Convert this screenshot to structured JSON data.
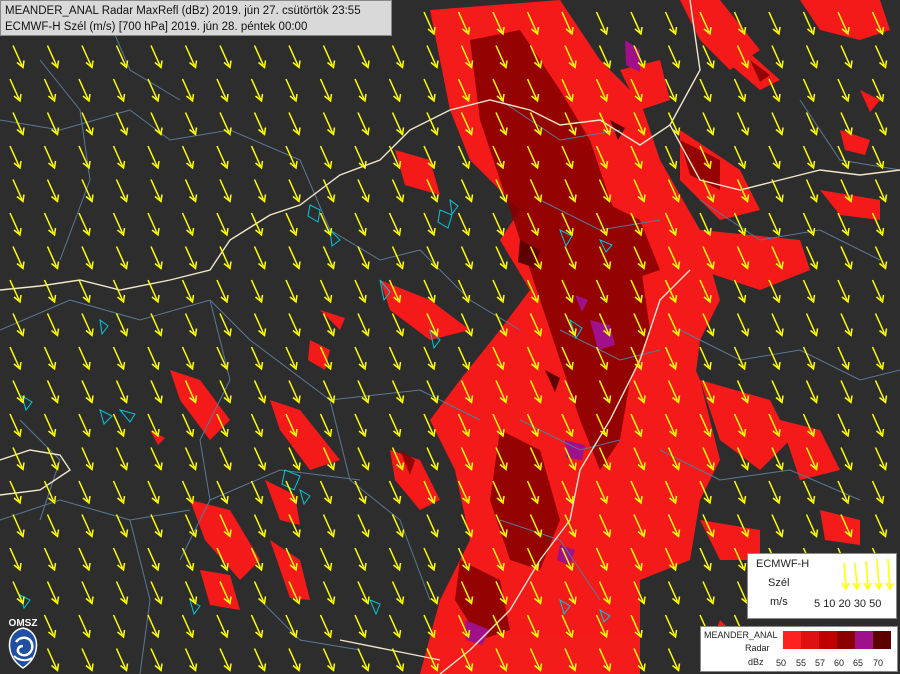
{
  "header": {
    "radar_line": "MEANDER_ANAL Radar MaxRefl (dBz) 2019. jún 27. csütörtök 23:55",
    "wind_line": "ECMWF-H Szél (m/s) [700 hPa] 2019. jún 28. péntek 00:00"
  },
  "wind_legend": {
    "model": "ECMWF-H",
    "variable": "Szél",
    "unit": "m/s",
    "ticks": [
      "5",
      "10",
      "20",
      "30",
      "50"
    ]
  },
  "radar_legend": {
    "model": "MEANDER_ANAL",
    "variable": "Radar",
    "unit": "dBz",
    "classes": [
      {
        "label": "50",
        "color": "#ff2020"
      },
      {
        "label": "55",
        "color": "#e01010"
      },
      {
        "label": "57",
        "color": "#c00000"
      },
      {
        "label": "60",
        "color": "#8b0000"
      },
      {
        "label": "65",
        "color": "#a0108a"
      },
      {
        "label": "70",
        "color": "#5c0000"
      }
    ]
  },
  "logo": {
    "text": "OMSZ"
  },
  "colors": {
    "background": "#2d2d2d",
    "wind_arrow": "#ffff00",
    "country_border": "#f0e6c8",
    "county_border": "#5a7896",
    "lakes": "#00c8dc"
  },
  "wind_field": {
    "direction": "NNW",
    "typical_speed_ms": 5
  }
}
